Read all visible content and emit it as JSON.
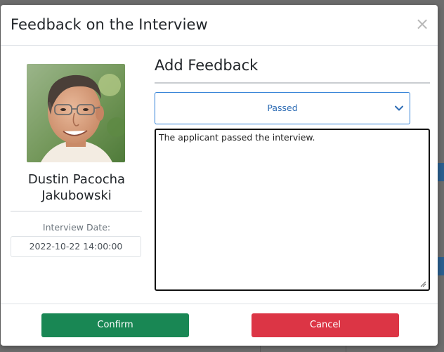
{
  "modal": {
    "title": "Feedback on the Interview",
    "close_label": "×"
  },
  "candidate": {
    "photo_alt": "candidate-photo",
    "name": "Dustin Pacocha Jakubowski",
    "interview_date_label": "Interview Date:",
    "interview_date": "2022-10-22 14:00:00"
  },
  "feedback": {
    "section_title": "Add Feedback",
    "result_select": {
      "selected": "Passed",
      "icon": "chevron-down-icon"
    },
    "comment": "The applicant passed the interview."
  },
  "footer": {
    "confirm_label": "Confirm",
    "cancel_label": "Cancel"
  },
  "colors": {
    "confirm": "#198754",
    "cancel": "#dc3545",
    "select_border": "#2f7fd6",
    "overlay": "#6d6d6d"
  }
}
